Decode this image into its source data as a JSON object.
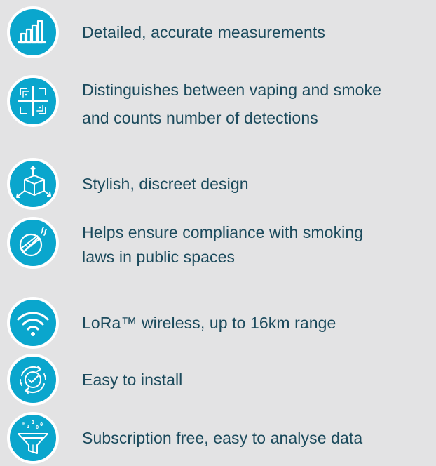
{
  "theme": {
    "background": "#e3e3e4",
    "text_color": "#1b4a5c",
    "icon_fill": "#0aa6cd",
    "icon_border": "#ffffff",
    "icon_stroke": "#ffffff"
  },
  "features": [
    {
      "icon": "bar-chart-icon",
      "lines": [
        "Detailed, accurate measurements"
      ]
    },
    {
      "icon": "scan-frame-icon",
      "lines": [
        "Distinguishes between vaping and smoke",
        "and counts number of detections"
      ]
    },
    {
      "icon": "3d-cube-icon",
      "lines": [
        "Stylish, discreet design"
      ]
    },
    {
      "icon": "no-smoking-icon",
      "lines": [
        "Helps ensure compliance with smoking",
        "laws in public spaces"
      ]
    },
    {
      "icon": "wifi-icon",
      "lines": [
        "LoRa™ wireless, up to 16km range"
      ]
    },
    {
      "icon": "check-cycle-icon",
      "lines": [
        "Easy to install"
      ]
    },
    {
      "icon": "data-funnel-icon",
      "lines": [
        "Subscription free, easy to analyse data"
      ]
    }
  ]
}
